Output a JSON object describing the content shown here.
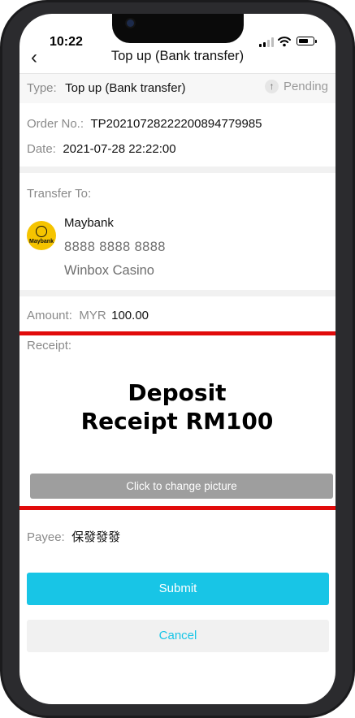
{
  "status": {
    "time": "10:22"
  },
  "nav": {
    "title": "Top up (Bank transfer)"
  },
  "type": {
    "label": "Type:",
    "value": "Top up (Bank transfer)",
    "status": "Pending"
  },
  "order": {
    "label": "Order No.:",
    "value": "TP20210728222200894779985"
  },
  "date": {
    "label": "Date:",
    "value": "2021-07-28 22:22:00"
  },
  "transfer": {
    "label": "Transfer To:",
    "bank_name": "Maybank",
    "account_number": "8888 8888 8888",
    "account_name": "Winbox Casino",
    "logo_text": "Maybank"
  },
  "amount": {
    "label": "Amount:",
    "currency": "MYR",
    "value": "100.00"
  },
  "receipt": {
    "label": "Receipt:",
    "image_line1": "Deposit",
    "image_line2": "Receipt RM100",
    "change_label": "Click to change picture",
    "highlight_color": "#e10b0b"
  },
  "payee": {
    "label": "Payee:",
    "value": "保發發發"
  },
  "buttons": {
    "submit": "Submit",
    "cancel": "Cancel"
  },
  "colors": {
    "accent": "#18c5e6"
  }
}
